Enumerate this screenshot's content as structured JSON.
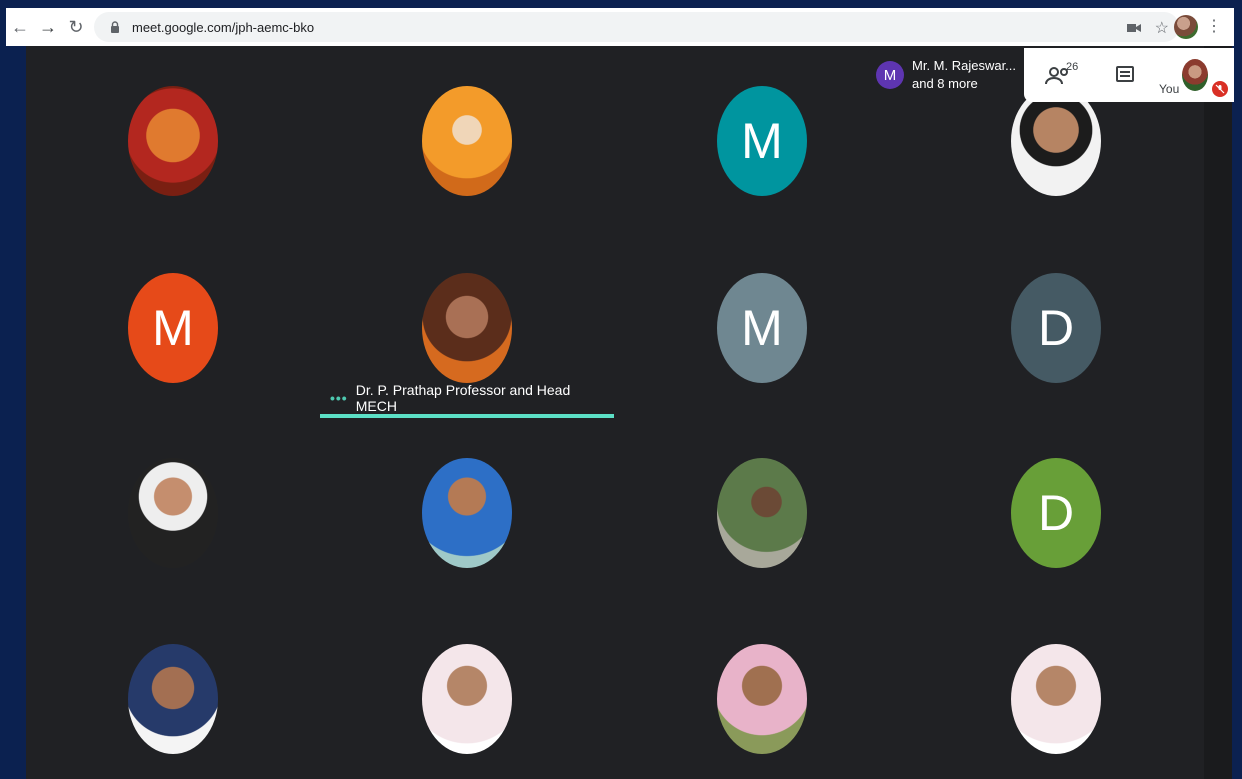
{
  "browser": {
    "url": "meet.google.com/jph-aemc-bko"
  },
  "meet": {
    "presenter_initial": "M",
    "presenter_name": "Mr. M. Rajeswar...",
    "presenter_more": "and 8 more",
    "participant_count": "26",
    "you_label": "You",
    "active_speaker": "Dr. P. Prathap Professor and Head MECH"
  },
  "tiles": [
    {
      "kind": "photo",
      "desc": "ganesha-image"
    },
    {
      "kind": "photo",
      "desc": "sai-baba-image"
    },
    {
      "kind": "letter",
      "letter": "M",
      "color": "#00959f"
    },
    {
      "kind": "photo",
      "desc": "man-photo"
    },
    {
      "kind": "letter",
      "letter": "M",
      "color": "#e64a19"
    },
    {
      "kind": "photo",
      "desc": "speaker-photo"
    },
    {
      "kind": "letter",
      "letter": "M",
      "color": "#6f8791"
    },
    {
      "kind": "letter",
      "letter": "D",
      "color": "#455a64"
    },
    {
      "kind": "photo",
      "desc": "man-suit-photo"
    },
    {
      "kind": "photo",
      "desc": "man-blue-shirt-photo"
    },
    {
      "kind": "photo",
      "desc": "man-outdoor-photo"
    },
    {
      "kind": "letter",
      "letter": "D",
      "color": "#689f38"
    },
    {
      "kind": "photo",
      "desc": "man-portrait-photo"
    },
    {
      "kind": "photo",
      "desc": "man-white-shirt-photo"
    },
    {
      "kind": "photo",
      "desc": "man-pink-shirt-photo"
    },
    {
      "kind": "photo",
      "desc": "man-white-shirt-photo-2"
    }
  ]
}
